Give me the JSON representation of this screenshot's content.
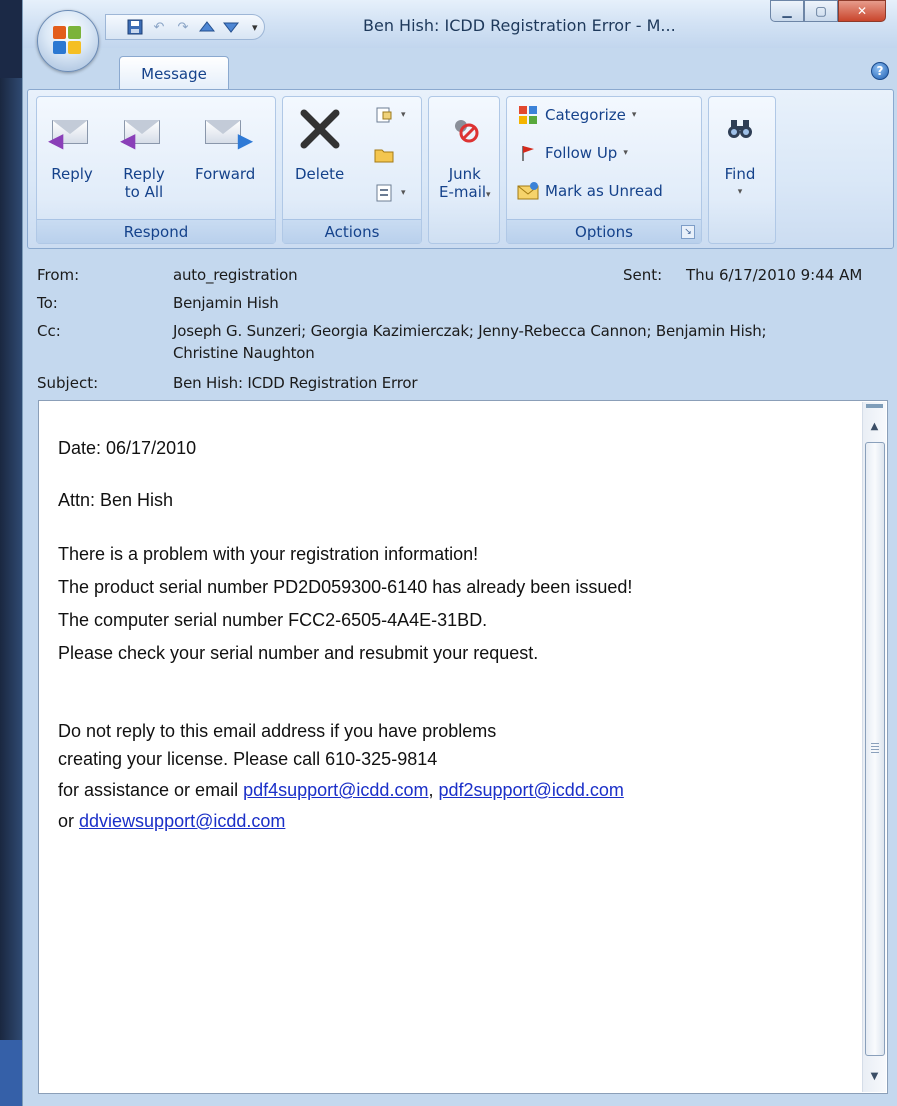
{
  "window": {
    "title": "Ben Hish:  ICDD Registration Error - M...",
    "controls": [
      "minimize",
      "maximize",
      "close"
    ]
  },
  "quick_access": [
    "save-icon",
    "undo-icon",
    "redo-icon",
    "previous-item-icon",
    "next-item-icon",
    "customize-icon"
  ],
  "ribbon": {
    "tab": "Message",
    "groups": {
      "respond": {
        "label": "Respond",
        "reply": "Reply",
        "reply_all_1": "Reply",
        "reply_all_2": "to All",
        "forward": "Forward"
      },
      "actions": {
        "label": "Actions",
        "delete": "Delete"
      },
      "junk": {
        "label_1": "Junk",
        "label_2": "E-mail"
      },
      "options": {
        "label": "Options",
        "categorize": "Categorize",
        "follow_up": "Follow Up",
        "mark_unread": "Mark as Unread"
      },
      "find": {
        "label": "Find"
      }
    }
  },
  "header": {
    "from_label": "From:",
    "from": "auto_registration",
    "sent_label": "Sent:",
    "sent": "Thu 6/17/2010 9:44 AM",
    "to_label": "To:",
    "to": "Benjamin Hish",
    "cc_label": "Cc:",
    "cc_line1": "Joseph G. Sunzeri; Georgia Kazimierczak; Jenny-Rebecca Cannon; Benjamin Hish;",
    "cc_line2": "Christine Naughton",
    "subject_label": "Subject:",
    "subject": "Ben Hish:  ICDD Registration Error"
  },
  "body": {
    "date": "Date: 06/17/2010",
    "attn": "Attn: Ben Hish",
    "p1": "There is a problem with your registration information!",
    "p2": "The product serial number PD2D059300-6140 has already been issued!",
    "p3": "The computer serial number FCC2-6505-4A4E-31BD.",
    "p4": "Please check your serial number and resubmit your request.",
    "n1": "Do not reply to this email address if you have problems",
    "n2": "creating your license.  Please call 610-325-9814",
    "n3_prefix": "for assistance or email ",
    "link1": "pdf4support@icdd.com",
    "sep": ", ",
    "link2": "pdf2support@icdd.com",
    "n4_prefix": "or ",
    "link3": "ddviewsupport@icdd.com"
  },
  "colors": {
    "ribbon_text": "#15428b",
    "link": "#1a2fc8",
    "close_button": "#c9452c"
  }
}
